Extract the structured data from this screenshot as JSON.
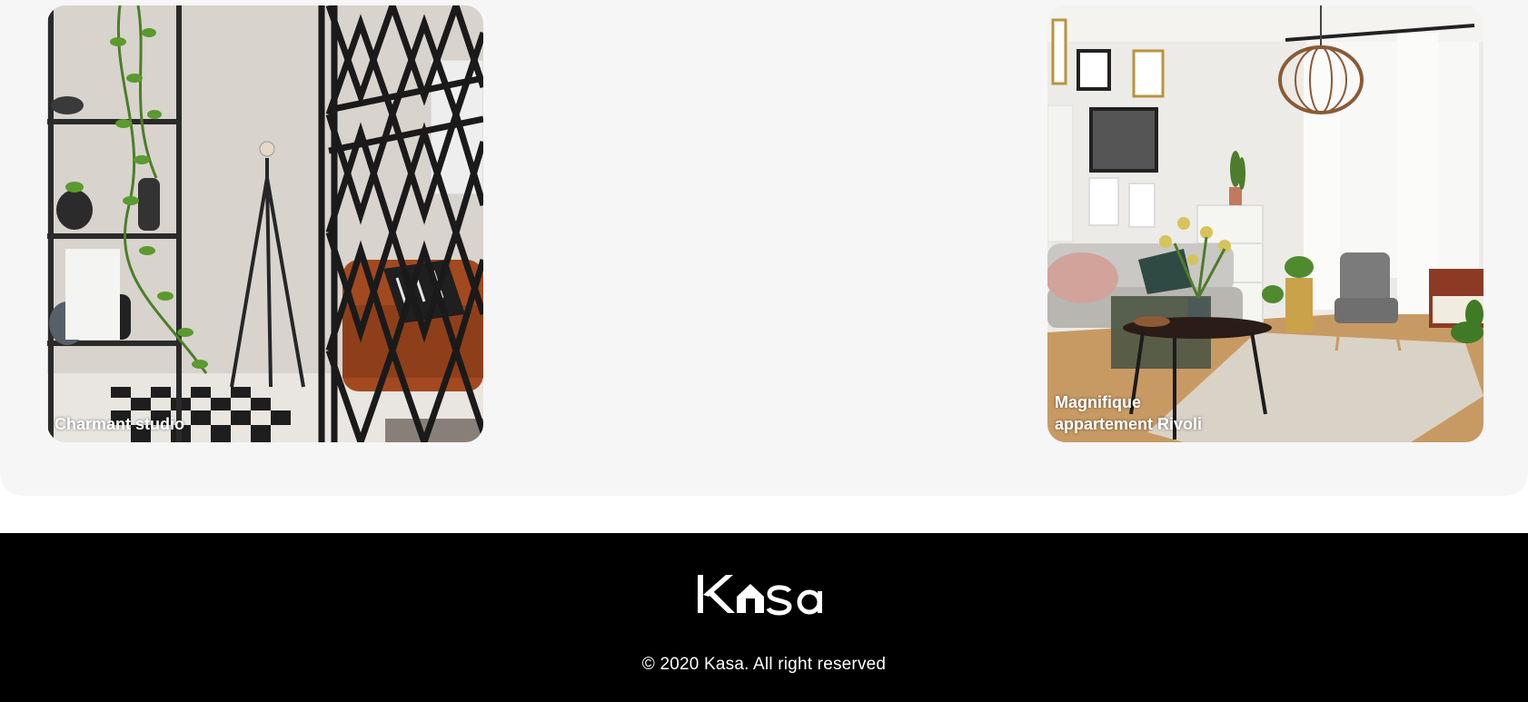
{
  "gallery": {
    "cards": [
      {
        "title": "Charmant studio",
        "image": "studio-interior-photo"
      },
      {
        "title": "Magnifique appartement Rivoli",
        "image": "living-room-photo"
      }
    ]
  },
  "footer": {
    "logo_text": "Kasa",
    "copyright": "© 2020 Kasa. All right reserved"
  },
  "colors": {
    "gallery_bg": "#f6f6f6",
    "footer_bg": "#000000",
    "text_light": "#ffffff"
  }
}
